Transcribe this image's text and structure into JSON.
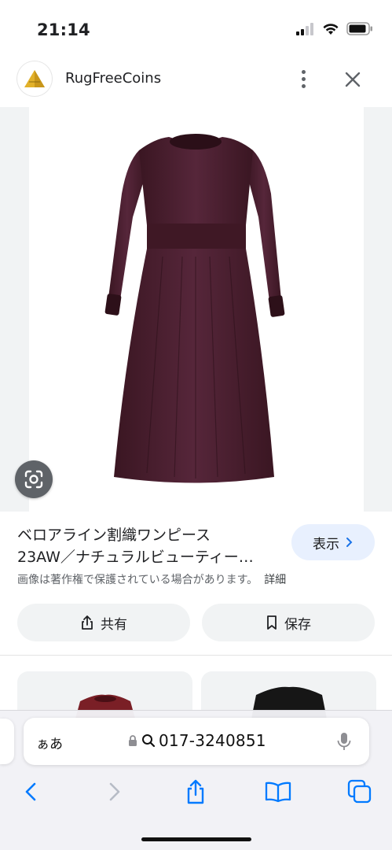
{
  "status_bar": {
    "time": "21:14"
  },
  "header": {
    "site_name": "RugFreeCoins"
  },
  "product": {
    "title_line1": "ベロアライン割織ワンピース",
    "title_line2": "23AW／ナチュラルビューティー…",
    "view_label": "表示",
    "copyright_notice": "画像は著作権で保護されている場合があります。",
    "details_link": "詳細"
  },
  "actions": {
    "share_label": "共有",
    "save_label": "保存"
  },
  "safari": {
    "aa_label": "ぁあ",
    "url": "017-3240851"
  },
  "colors": {
    "dress": "#4a1f2c",
    "accent_blue": "#007aff",
    "chip_bg": "#e8f0fe"
  },
  "icons": [
    "cellular-icon",
    "wifi-icon",
    "battery-icon",
    "more-vert-icon",
    "close-icon",
    "lens-icon",
    "chevron-right-icon",
    "share-icon",
    "bookmark-icon",
    "lock-icon",
    "search-icon",
    "mic-icon",
    "back-icon",
    "forward-icon",
    "bookmarks-icon",
    "tabs-icon"
  ]
}
